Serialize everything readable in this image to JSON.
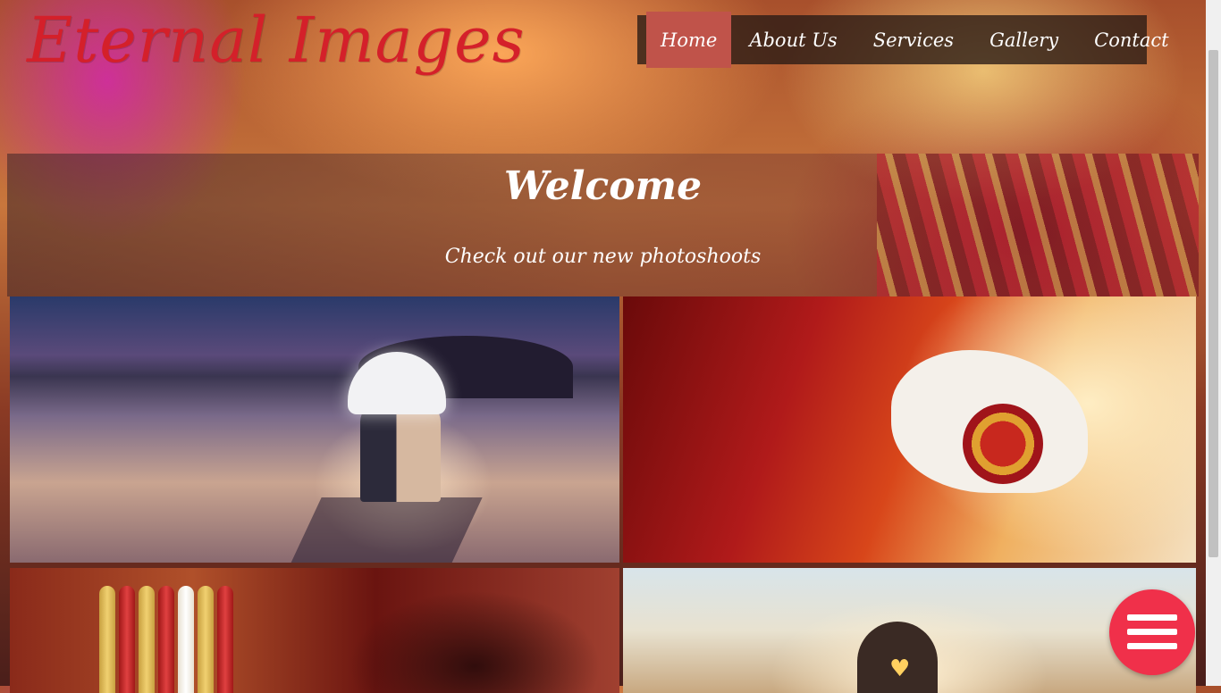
{
  "brand": {
    "logo_text": "Eternal Images"
  },
  "nav": {
    "items": [
      {
        "label": "Home",
        "active": true
      },
      {
        "label": "About Us",
        "active": false
      },
      {
        "label": "Services",
        "active": false
      },
      {
        "label": "Gallery",
        "active": false
      },
      {
        "label": "Contact",
        "active": false
      }
    ]
  },
  "welcome": {
    "title": "Welcome",
    "subtitle": "Check out our new photoshoots"
  },
  "colors": {
    "logo": "#d4202a",
    "nav_active": "#c0534a",
    "fab": "#f0304a"
  },
  "icons": {
    "fab_icon": "hamburger-menu-icon"
  }
}
